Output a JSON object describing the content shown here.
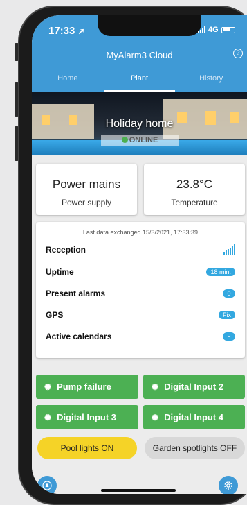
{
  "status": {
    "time": "17:33",
    "location_glyph": "➚",
    "network": "4G"
  },
  "header": {
    "title": "MyAlarm3 Cloud",
    "help_icon": "help-icon"
  },
  "tabs": [
    {
      "label": "Home",
      "active": false
    },
    {
      "label": "Plant",
      "active": true
    },
    {
      "label": "History",
      "active": false
    }
  ],
  "hero": {
    "title": "Holiday home",
    "status": "ONLINE",
    "status_color": "#4caf50"
  },
  "cards": {
    "power": {
      "value": "Power mains",
      "label": "Power supply"
    },
    "temperature": {
      "value": "23.8°C",
      "label": "Temperature"
    }
  },
  "info": {
    "last_data": "Last data exchanged 15/3/2021, 17:33:39",
    "rows": [
      {
        "label": "Reception",
        "value": ""
      },
      {
        "label": "Uptime",
        "value": "18 min."
      },
      {
        "label": "Present alarms",
        "value": "0"
      },
      {
        "label": "GPS",
        "value": "Fix"
      },
      {
        "label": "Active calendars",
        "value": "-"
      }
    ]
  },
  "inputs": [
    "Pump failure",
    "Digital Input 2",
    "Digital Input 3",
    "Digital Input 4"
  ],
  "lights": {
    "pool": {
      "label": "Pool lights ON",
      "color": "#f5d327"
    },
    "garden": {
      "label": "Garden spotlights OFF",
      "color": "#d8d8d8"
    }
  },
  "colors": {
    "accent": "#3f9ad6",
    "green": "#4cb053"
  }
}
